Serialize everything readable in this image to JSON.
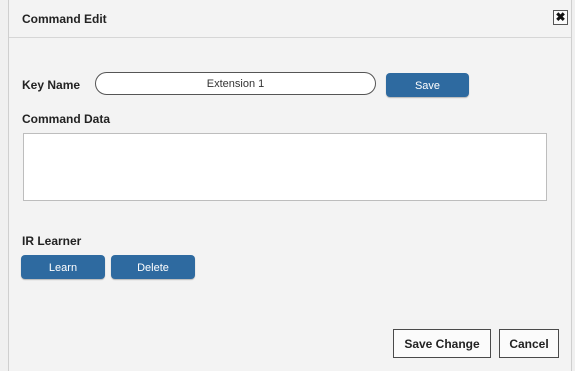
{
  "dialog": {
    "title": "Command Edit",
    "close_glyph": "✖",
    "close_icon": "close-icon"
  },
  "key_name": {
    "label": "Key Name",
    "value": "Extension 1",
    "save_label": "Save"
  },
  "command_data": {
    "label": "Command Data",
    "value": ""
  },
  "ir_learner": {
    "label": "IR Learner",
    "learn_label": "Learn",
    "delete_label": "Delete"
  },
  "footer": {
    "save_change_label": "Save Change",
    "cancel_label": "Cancel"
  },
  "colors": {
    "accent_button": "#2e6aa0",
    "background": "#f3f3f3"
  }
}
